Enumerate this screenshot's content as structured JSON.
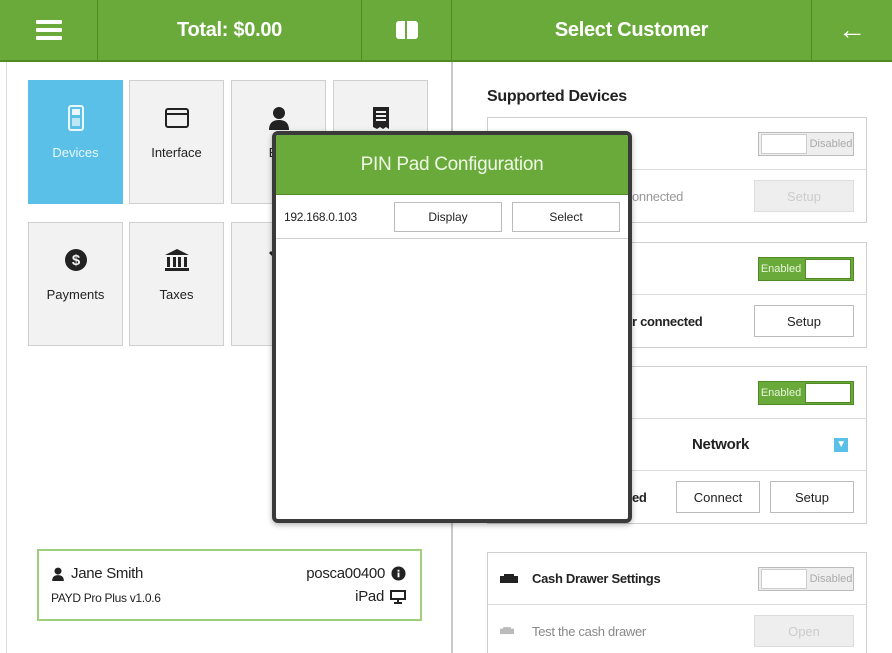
{
  "topbar": {
    "total": "Total: $0.00",
    "customer": "Select Customer"
  },
  "tiles": [
    {
      "label": "Devices",
      "icon": "card-reader-icon",
      "active": true
    },
    {
      "label": "Interface",
      "icon": "window-icon"
    },
    {
      "label": "Em",
      "icon": "person-icon"
    },
    {
      "label": "",
      "icon": "receipt-icon"
    },
    {
      "label": "Payments",
      "icon": "dollar-coin-icon"
    },
    {
      "label": "Taxes",
      "icon": "bank-icon"
    },
    {
      "label": "T",
      "icon": "wrench-icon"
    }
  ],
  "user": {
    "name": "Jane Smith",
    "account": "posca00400",
    "version": "PAYD Pro Plus v1.0.6",
    "device": "iPad"
  },
  "right": {
    "title": "Supported Devices",
    "card1": {
      "toggle": "Disabled",
      "status": "onnected",
      "setup": "Setup"
    },
    "card2": {
      "toggle": "Enabled",
      "status": "r connected",
      "setup": "Setup"
    },
    "card3": {
      "toggle": "Enabled",
      "select_value": "Network",
      "status": "ed",
      "connect": "Connect",
      "setup": "Setup"
    },
    "card4": {
      "title": "Cash Drawer Settings",
      "toggle": "Disabled",
      "test_label": "Test the cash drawer",
      "open": "Open"
    }
  },
  "modal": {
    "title": "PIN Pad Configuration",
    "ip": "192.168.0.103",
    "display": "Display",
    "select": "Select"
  },
  "colors": {
    "accent": "#6aaa3a",
    "active_tile": "#5bc0e8"
  }
}
